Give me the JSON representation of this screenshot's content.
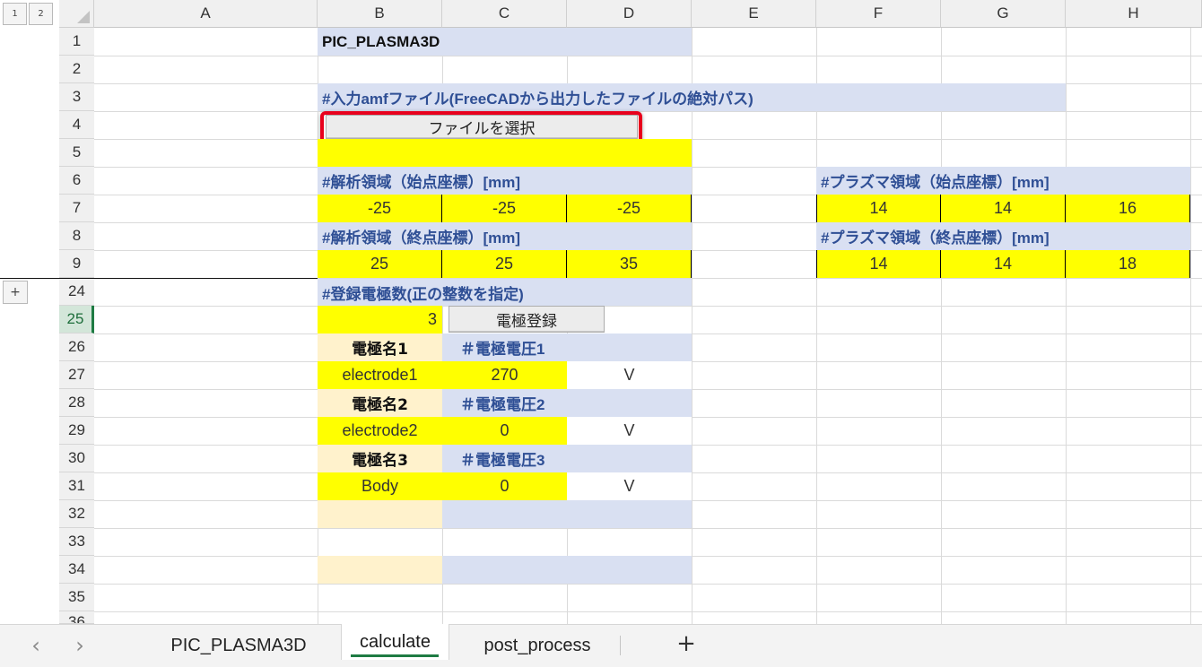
{
  "outline": {
    "level1": "1",
    "level2": "2",
    "expand": "+"
  },
  "columns": [
    "A",
    "B",
    "C",
    "D",
    "E",
    "F",
    "G",
    "H"
  ],
  "rows": [
    "1",
    "2",
    "3",
    "4",
    "5",
    "6",
    "7",
    "8",
    "9",
    "24",
    "25",
    "26",
    "27",
    "28",
    "29",
    "30",
    "31",
    "32",
    "33",
    "34",
    "35",
    "36"
  ],
  "active_row": "25",
  "cells": {
    "title": "PIC_PLASMA3D",
    "amf_header": "#入力amfファイル(FreeCADから出力したファイルの絶対パス)",
    "select_file_button": "ファイルを選択",
    "domain_start_header": "#解析領域（始点座標）[mm]",
    "domain_start": [
      "-25",
      "-25",
      "-25"
    ],
    "domain_end_header": "#解析領域（終点座標）[mm]",
    "domain_end": [
      "25",
      "25",
      "35"
    ],
    "plasma_start_header": "#プラズマ領域（始点座標）[mm]",
    "plasma_start": [
      "14",
      "14",
      "16"
    ],
    "plasma_end_header": "#プラズマ領域（終点座標）[mm]",
    "plasma_end": [
      "14",
      "14",
      "18"
    ],
    "electrode_count_header": "#登録電極数(正の整数を指定)",
    "electrode_count": "3",
    "register_button": "電極登録",
    "electrodes": [
      {
        "name_label": "電極名1",
        "voltage_label": "＃電極電圧1",
        "name": "electrode1",
        "voltage": "270",
        "unit": "V"
      },
      {
        "name_label": "電極名2",
        "voltage_label": "＃電極電圧2",
        "name": "electrode2",
        "voltage": "0",
        "unit": "V"
      },
      {
        "name_label": "電極名3",
        "voltage_label": "＃電極電圧3",
        "name": "Body",
        "voltage": "0",
        "unit": "V"
      }
    ]
  },
  "sheet_tabs": {
    "prev": "‹",
    "next": "›",
    "tabs": [
      "PIC_PLASMA3D",
      "calculate",
      "post_process"
    ],
    "active": "calculate",
    "add": "+"
  },
  "colors": {
    "header_fill": "#d9e0f2",
    "input_fill": "#ffff00",
    "label_fill": "#fff2cc",
    "header_text": "#2f4f95",
    "highlight_border": "#e8001c",
    "active_accent": "#1e7b43"
  }
}
